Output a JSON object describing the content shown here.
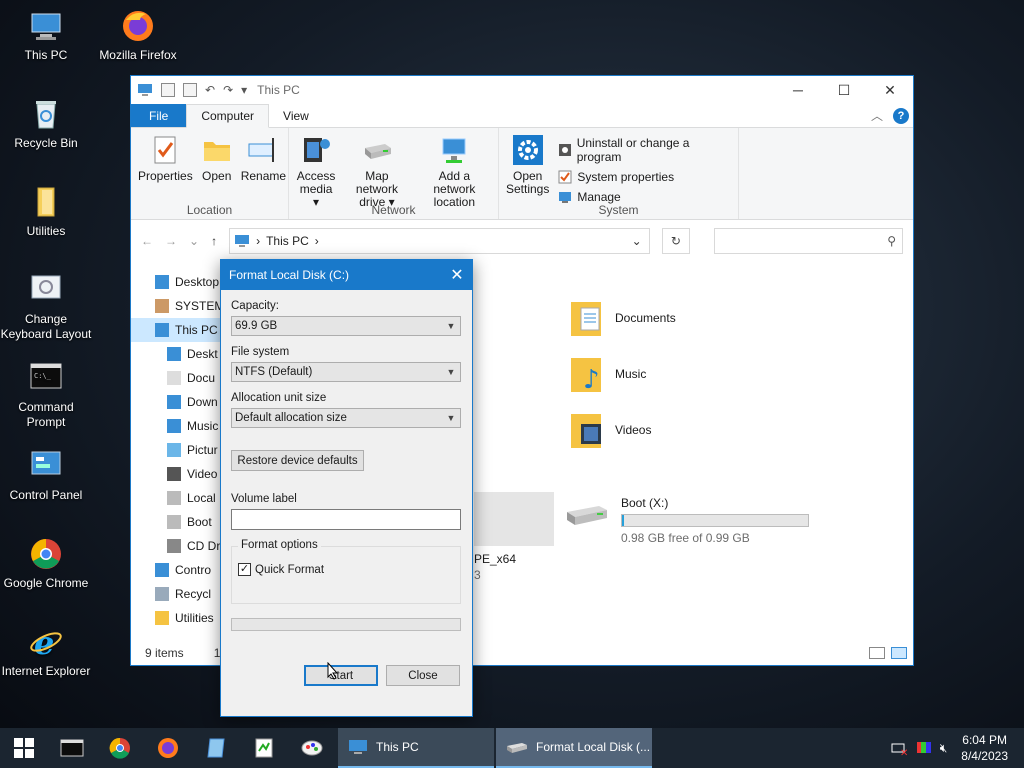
{
  "desktop": {
    "icons": [
      {
        "label": "This PC",
        "icon": "computer-icon"
      },
      {
        "label": "Mozilla Firefox",
        "icon": "firefox-icon"
      },
      {
        "label": "Recycle Bin",
        "icon": "recycle-bin-icon"
      },
      {
        "label": "Utilities",
        "icon": "folder-icon"
      },
      {
        "label": "Change Keyboard Layout",
        "icon": "keyboard-icon"
      },
      {
        "label": "Command Prompt",
        "icon": "terminal-icon"
      },
      {
        "label": "Control Panel",
        "icon": "control-panel-icon"
      },
      {
        "label": "Google Chrome",
        "icon": "chrome-icon"
      },
      {
        "label": "Internet Explorer",
        "icon": "ie-icon"
      }
    ]
  },
  "explorer": {
    "title": "This PC",
    "tabs": {
      "file": "File",
      "computer": "Computer",
      "view": "View"
    },
    "ribbon": {
      "location": {
        "label": "Location",
        "properties": "Properties",
        "open": "Open",
        "rename": "Rename"
      },
      "network": {
        "label": "Network",
        "access_media_1": "Access",
        "access_media_2": "media ▾",
        "map_drive_1": "Map network",
        "map_drive_2": "drive ▾",
        "add_loc_1": "Add a network",
        "add_loc_2": "location"
      },
      "system": {
        "label": "System",
        "open_settings_1": "Open",
        "open_settings_2": "Settings",
        "uninstall": "Uninstall or change a program",
        "sys_props": "System properties",
        "manage": "Manage"
      }
    },
    "address": "This PC",
    "search_placeholder": "",
    "nav": [
      {
        "label": "Desktop",
        "level": 1
      },
      {
        "label": "SYSTEM",
        "level": 1
      },
      {
        "label": "This PC",
        "level": 1,
        "selected": true
      },
      {
        "label": "Deskt",
        "level": 2
      },
      {
        "label": "Docu",
        "level": 2
      },
      {
        "label": "Down",
        "level": 2
      },
      {
        "label": "Music",
        "level": 2
      },
      {
        "label": "Pictur",
        "level": 2
      },
      {
        "label": "Video",
        "level": 2
      },
      {
        "label": "Local",
        "level": 2
      },
      {
        "label": "Boot",
        "level": 2
      },
      {
        "label": "CD Dr",
        "level": 2
      },
      {
        "label": "Contro",
        "level": 1
      },
      {
        "label": "Recycl",
        "level": 1
      },
      {
        "label": "Utilities",
        "level": 1
      }
    ],
    "folders": {
      "documents": "Documents",
      "music": "Music",
      "videos": "Videos"
    },
    "drive_partial_name": "PE_x64",
    "drive_partial_free": "3",
    "boot_drive": {
      "name": "Boot (X:)",
      "free": "0.98 GB free of 0.99 GB",
      "used_fraction": 0.01
    },
    "status": {
      "items": "9 items",
      "selected": "1 it"
    }
  },
  "dialog": {
    "title": "Format Local Disk (C:)",
    "capacity_label": "Capacity:",
    "capacity_value": "69.9 GB",
    "fs_label": "File system",
    "fs_value": "NTFS (Default)",
    "alloc_label": "Allocation unit size",
    "alloc_value": "Default allocation size",
    "restore_btn": "Restore device defaults",
    "volume_label": "Volume label",
    "volume_value": "",
    "format_options": "Format options",
    "quick_format": "Quick Format",
    "quick_checked": "✓",
    "progress": 0,
    "start_btn": "Start",
    "close_btn": "Close"
  },
  "taskbar": {
    "win1": "This PC",
    "win2": "Format Local Disk (...",
    "time": "6:04 PM",
    "date": "8/4/2023"
  }
}
